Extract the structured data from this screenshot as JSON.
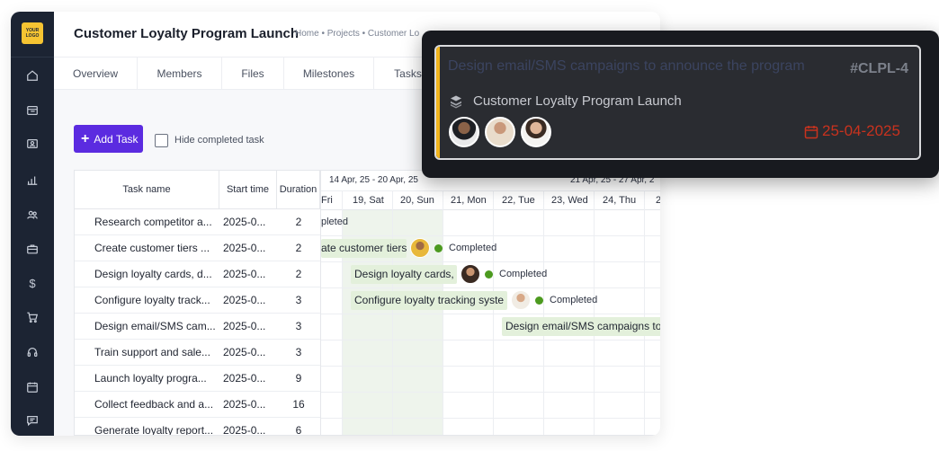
{
  "sidebar": {
    "logo_text": "YOUR LOGO",
    "icons": [
      "home-icon",
      "board-icon",
      "contact-card-icon",
      "reports-chart-icon",
      "users-icon",
      "briefcase-icon",
      "dollar-icon",
      "cart-icon",
      "headset-icon",
      "calendar-icon",
      "chat-icon"
    ],
    "dollar_glyph": "$"
  },
  "header": {
    "title": "Customer Loyalty Program Launch",
    "breadcrumb": "Home • Projects • Customer Lo"
  },
  "tabs": [
    "Overview",
    "Members",
    "Files",
    "Milestones",
    "Tasks"
  ],
  "toolbar": {
    "add_task_label": "Add Task",
    "add_task_icon": "+",
    "hide_completed_label": "Hide completed task",
    "hide_completed_checked": false
  },
  "table": {
    "columns": [
      "Task name",
      "Start time",
      "Duration"
    ],
    "rows": [
      {
        "name": "Research competitor a...",
        "start": "2025-0...",
        "duration": "2"
      },
      {
        "name": "Create customer tiers ...",
        "start": "2025-0...",
        "duration": "2"
      },
      {
        "name": "Design loyalty cards, d...",
        "start": "2025-0...",
        "duration": "2"
      },
      {
        "name": "Configure loyalty track...",
        "start": "2025-0...",
        "duration": "3"
      },
      {
        "name": "Design email/SMS cam...",
        "start": "2025-0...",
        "duration": "3"
      },
      {
        "name": "Train support and sale...",
        "start": "2025-0...",
        "duration": "3"
      },
      {
        "name": "Launch loyalty progra...",
        "start": "2025-0...",
        "duration": "9"
      },
      {
        "name": "Collect feedback and a...",
        "start": "2025-0...",
        "duration": "16"
      },
      {
        "name": "Generate loyalty report...",
        "start": "2025-0...",
        "duration": "6"
      }
    ]
  },
  "gantt": {
    "weeks": [
      "14 Apr, 25 - 20 Apr, 25",
      "21 Apr, 25 - 27 Apr, 2"
    ],
    "days": [
      "Fri",
      "19, Sat",
      "20, Sun",
      "21, Mon",
      "22, Tue",
      "23, Wed",
      "24, Thu",
      "2"
    ],
    "bars": [
      {
        "label": "pleted",
        "status": ""
      },
      {
        "label": "ate customer tiers",
        "status": "Completed"
      },
      {
        "label": "Design loyalty cards,",
        "status": "Completed"
      },
      {
        "label": "Configure loyalty tracking syste",
        "status": "Completed"
      },
      {
        "label": "Design email/SMS campaigns to",
        "status": ""
      }
    ],
    "status_color": "#4c9a1f",
    "bar_color": "#e3f0db"
  },
  "popup": {
    "task_title": "Design email/SMS campaigns to announce the program",
    "task_id": "#CLPL-4",
    "project_name": "Customer Loyalty Program Launch",
    "project_icon": "layers-icon",
    "due_icon": "calendar-icon",
    "due_date": "25-04-2025",
    "accent_color": "#f2b51d",
    "date_color": "#c8321e"
  },
  "colors": {
    "brand": "#5b2be0",
    "sidebar": "#1c2433",
    "logo": "#f6c432"
  }
}
